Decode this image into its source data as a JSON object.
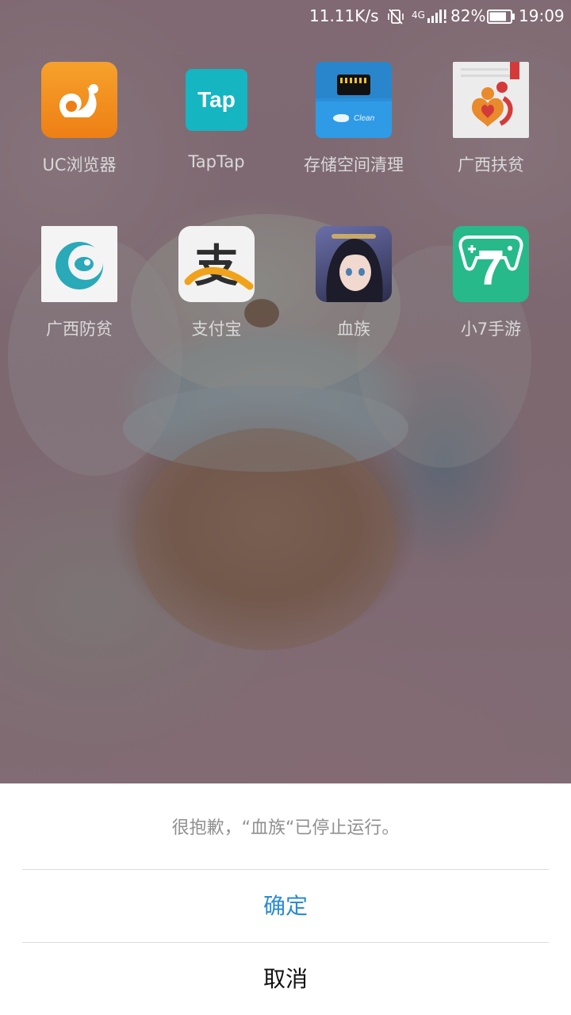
{
  "status_bar": {
    "net_speed": "11.11K/s",
    "signal_label": "4G",
    "battery_percent": "82%",
    "battery_level": 0.82,
    "time": "19:09"
  },
  "apps": [
    {
      "label": "UC浏览器",
      "icon": "uc-browser-icon",
      "color": "#f18d1d"
    },
    {
      "label": "TapTap",
      "icon": "taptap-icon",
      "icon_text": "Tap",
      "color": "#14b9c6"
    },
    {
      "label": "存储空间清理",
      "icon": "storage-cleaner-icon",
      "icon_text": "Clean",
      "color": "#2a8dd8"
    },
    {
      "label": "广西扶贫",
      "icon": "guangxi-poverty-aid-icon",
      "color": "#f2f2f2"
    },
    {
      "label": "广西防贫",
      "icon": "guangxi-poverty-prevention-icon",
      "color": "#f7f7f7"
    },
    {
      "label": "支付宝",
      "icon": "alipay-icon",
      "icon_text": "支",
      "color": "#f5f5f5"
    },
    {
      "label": "血族",
      "icon": "bloodline-game-icon",
      "color": "#3a3f6a"
    },
    {
      "label": "小7手游",
      "icon": "xiao7-games-icon",
      "icon_text": "7",
      "color": "#2bbf8c"
    }
  ],
  "dialog": {
    "message": "很抱歉，“血族“已停止运行。",
    "confirm_label": "确定",
    "cancel_label": "取消",
    "confirm_color": "#2a8bd4",
    "cancel_color": "#111111"
  }
}
